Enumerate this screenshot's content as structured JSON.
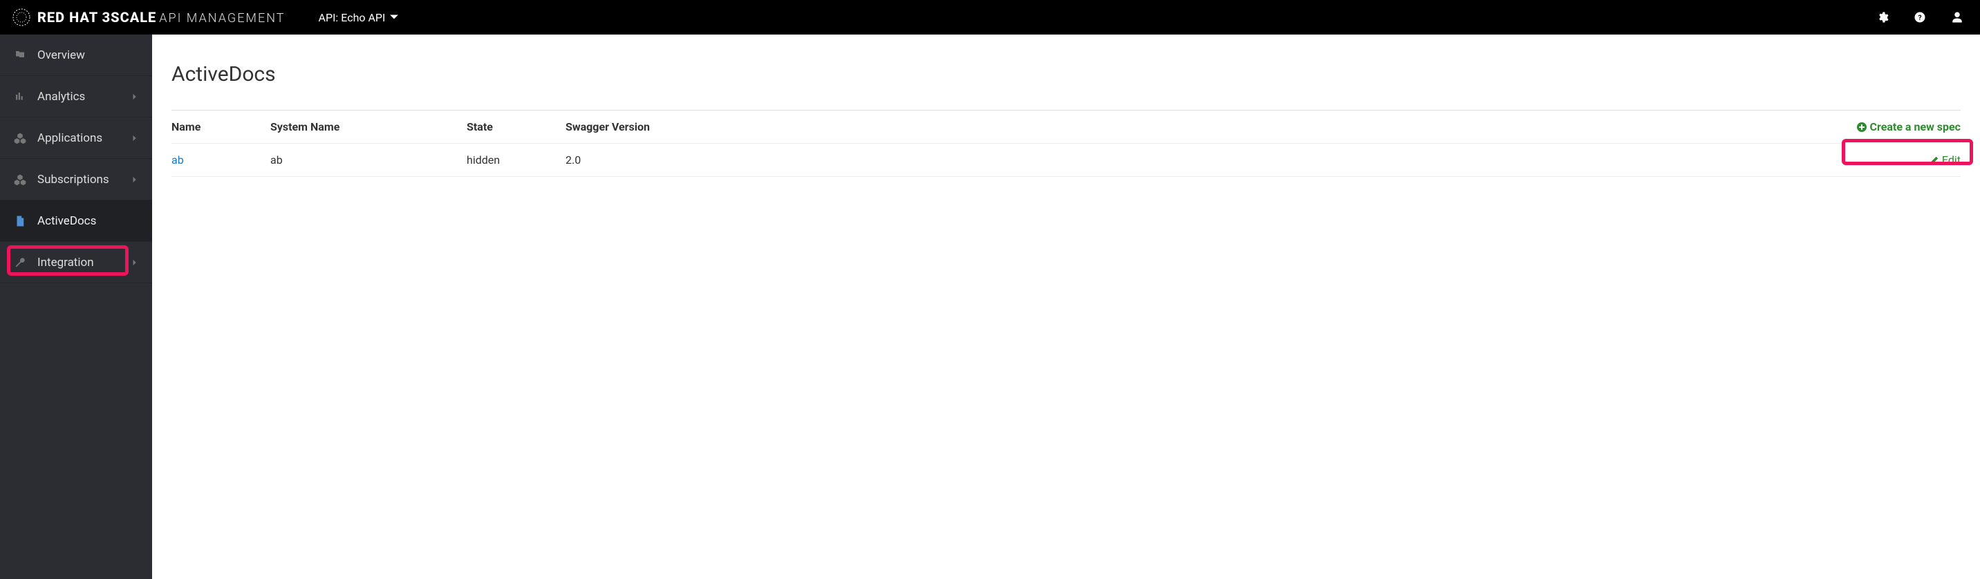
{
  "header": {
    "brand_bold": "RED HAT 3SCALE",
    "brand_thin": "API MANAGEMENT",
    "api_selector_label": "API: Echo API"
  },
  "sidebar": {
    "items": [
      {
        "label": "Overview",
        "icon": "flag-icon",
        "expandable": false,
        "active": false
      },
      {
        "label": "Analytics",
        "icon": "chart-icon",
        "expandable": true,
        "active": false
      },
      {
        "label": "Applications",
        "icon": "cubes-icon",
        "expandable": true,
        "active": false
      },
      {
        "label": "Subscriptions",
        "icon": "cubes-icon",
        "expandable": true,
        "active": false
      },
      {
        "label": "ActiveDocs",
        "icon": "document-icon",
        "expandable": false,
        "active": true
      },
      {
        "label": "Integration",
        "icon": "wrench-icon",
        "expandable": true,
        "active": false
      }
    ]
  },
  "main": {
    "page_title": "ActiveDocs",
    "create_label": "Create a new spec",
    "edit_label": "Edit",
    "table": {
      "headers": {
        "name": "Name",
        "system_name": "System Name",
        "state": "State",
        "swagger": "Swagger Version"
      },
      "rows": [
        {
          "name": "ab",
          "system_name": "ab",
          "state": "hidden",
          "swagger": "2.0"
        }
      ]
    }
  }
}
